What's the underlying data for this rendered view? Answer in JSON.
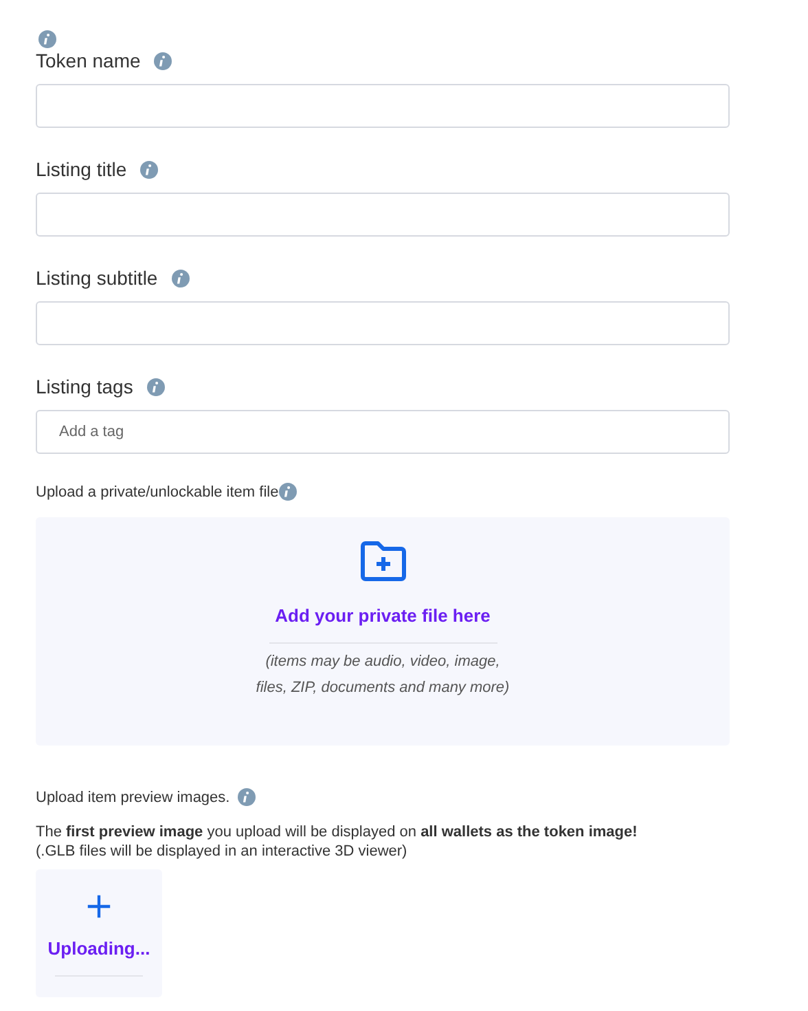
{
  "fields": [
    {
      "label": "Token name"
    },
    {
      "label": "Listing title"
    },
    {
      "label": "Listing subtitle"
    },
    {
      "label": "Listing tags",
      "placeholder": "Add a tag"
    }
  ],
  "private_file": {
    "label": "Upload a private/unlockable item file",
    "title": "Add your private file here",
    "note": "(items may be audio, video, image, files, ZIP, documents and many more)"
  },
  "preview": {
    "label": "Upload item preview images.",
    "description": "The **first preview image** you upload will be displayed on **all wallets as the token image!**",
    "note": "(.GLB files will be displayed in an interactive 3D viewer)",
    "tile_label": "Uploading..."
  }
}
